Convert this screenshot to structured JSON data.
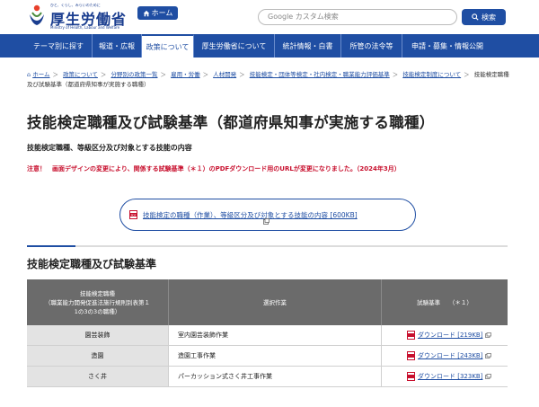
{
  "header": {
    "logo_tagline": "ひと、くらし、みらいのために",
    "logo_title": "厚生労働省",
    "logo_sub": "Ministry of Health, Labour and Welfare",
    "home_label": "ホーム",
    "top_links": "・・・　　　　　　　　・・・・・・・・・・・・・",
    "search_placeholder": "Google カスタム検索",
    "search_label": "検索",
    "brand_color": "#1f4ea3"
  },
  "nav": {
    "items": [
      {
        "label": "テーマ別に探す"
      },
      {
        "label": "報道・広報"
      },
      {
        "label": "政策について"
      },
      {
        "label": "厚生労働省について"
      },
      {
        "label": "統計情報・白書"
      },
      {
        "label": "所管の法令等"
      },
      {
        "label": "申請・募集・情報公開"
      }
    ],
    "active_index": 2
  },
  "breadcrumb": {
    "items": [
      "ホーム",
      "政策について",
      "分野別の政策一覧",
      "雇用・労働",
      "人材開発",
      "技能検定・団体等検定・社内検定・職業能力評価基準",
      "技能検定制度について"
    ],
    "current": "技能検定職種及び試験基準（都道府県知事が実施する職種）"
  },
  "main": {
    "title": "技能検定職種及び試験基準（都道府県知事が実施する職種）",
    "subtitle": "技能検定職種、等級区分及び対象とする技能の内容",
    "notice": "注意！　画面デザインの変更により、関係する試験基準（＊１）のPDFダウンロード用のURLが変更になりました。（2024年3月）",
    "download_box": "技能検定の職種（作業）、等級区分及び対象とする技能の内容 [600KB]",
    "section_title": "技能検定職種及び試験基準"
  },
  "table": {
    "headers": {
      "job": "技能検定職種\n（職業能力開発促進法施行規則別表第１\n1の3の3の職種）",
      "work": "選択作業",
      "standard": "試験基準　　（＊１）"
    },
    "rows": [
      {
        "job": "園芸装飾",
        "work": "室内園芸装飾作業",
        "download": "ダウンロード [219KB]"
      },
      {
        "job": "造園",
        "work": "造園工事作業",
        "download": "ダウンロード [243KB]"
      },
      {
        "job": "さく井",
        "work": "パーカッション式さく井工事作業",
        "download": "ダウンロード [323KB]"
      }
    ]
  },
  "icons": {
    "home": "home-icon",
    "search": "search-icon",
    "pdf": "pdf-icon",
    "external": "external-window-icon"
  }
}
